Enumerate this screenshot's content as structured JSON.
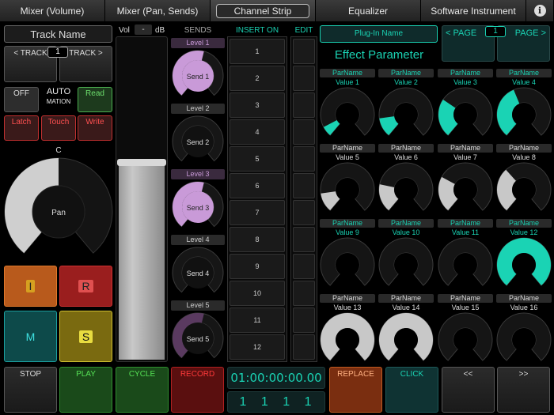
{
  "tabs": [
    {
      "label": "Mixer (Volume)"
    },
    {
      "label": "Mixer (Pan, Sends)"
    },
    {
      "label": "Channel Strip"
    },
    {
      "label": "Equalizer"
    },
    {
      "label": "Software Instrument"
    }
  ],
  "info_icon": "i",
  "track": {
    "name": "Track Name",
    "prev": "< TRACK",
    "next": "TRACK >",
    "number": "1"
  },
  "automation": {
    "off": "OFF",
    "label_line1": "AUTO",
    "label_line2": "MATION",
    "read": "Read",
    "latch": "Latch",
    "touch": "Touch",
    "write": "Write"
  },
  "pan": {
    "center": "C",
    "label": "Pan",
    "value": 0.5
  },
  "channel_buttons": {
    "i": "I",
    "r": "R",
    "m": "M",
    "s": "S"
  },
  "volume": {
    "vol": "Vol",
    "value": "-",
    "unit": "dB",
    "level": 0.62
  },
  "sends": {
    "title": "SENDS",
    "items": [
      {
        "level": "Level 1",
        "label": "Send 1",
        "value": 0.55,
        "active": true
      },
      {
        "level": "Level 2",
        "label": "Send 2",
        "value": 0.0,
        "active": false
      },
      {
        "level": "Level 3",
        "label": "Send 3",
        "value": 0.55,
        "active": true
      },
      {
        "level": "Level 4",
        "label": "Send 4",
        "value": 0.0,
        "active": false
      },
      {
        "level": "Level 5",
        "label": "Send 5",
        "value": 0.55,
        "active": false
      }
    ]
  },
  "inserts": {
    "title": "INSERT ON",
    "edit": "EDIT",
    "slots": [
      "1",
      "2",
      "3",
      "4",
      "5",
      "6",
      "7",
      "8",
      "9",
      "10",
      "11",
      "12"
    ]
  },
  "plugin": {
    "name": "Plug-In Name",
    "page_prev": "< PAGE",
    "page_num": "1",
    "page_next": "PAGE >",
    "title": "Effect Parameter"
  },
  "params": [
    {
      "name": "ParName",
      "value": "Value 1",
      "level": 0.08,
      "color": "#1ad3b4",
      "text_color": "#1ad3b4"
    },
    {
      "name": "ParName",
      "value": "Value 2",
      "level": 0.15,
      "color": "#1ad3b4",
      "text_color": "#1ad3b4"
    },
    {
      "name": "ParName",
      "value": "Value 3",
      "level": 0.3,
      "color": "#1ad3b4",
      "text_color": "#1ad3b4"
    },
    {
      "name": "ParName",
      "value": "Value 4",
      "level": 0.42,
      "color": "#1ad3b4",
      "text_color": "#1ad3b4"
    },
    {
      "name": "ParName",
      "value": "Value 5",
      "level": 0.15,
      "color": "#c8c8c8",
      "text_color": "#dddddd"
    },
    {
      "name": "ParName",
      "value": "Value 6",
      "level": 0.22,
      "color": "#c8c8c8",
      "text_color": "#dddddd"
    },
    {
      "name": "ParName",
      "value": "Value 7",
      "level": 0.28,
      "color": "#c8c8c8",
      "text_color": "#dddddd"
    },
    {
      "name": "ParName",
      "value": "Value 8",
      "level": 0.35,
      "color": "#c8c8c8",
      "text_color": "#dddddd"
    },
    {
      "name": "ParName",
      "value": "Value 9",
      "level": 0.0,
      "color": "#1ad3b4",
      "text_color": "#1ad3b4"
    },
    {
      "name": "ParName",
      "value": "Value 10",
      "level": 0.0,
      "color": "#1ad3b4",
      "text_color": "#1ad3b4"
    },
    {
      "name": "ParName",
      "value": "Value 11",
      "level": 0.0,
      "color": "#1ad3b4",
      "text_color": "#1ad3b4"
    },
    {
      "name": "ParName",
      "value": "Value 12",
      "level": 1.0,
      "color": "#1ad3b4",
      "text_color": "#1ad3b4"
    },
    {
      "name": "ParName",
      "value": "Value 13",
      "level": 1.0,
      "color": "#c8c8c8",
      "text_color": "#dddddd"
    },
    {
      "name": "ParName",
      "value": "Value 14",
      "level": 1.0,
      "color": "#c8c8c8",
      "text_color": "#dddddd"
    },
    {
      "name": "ParName",
      "value": "Value 15",
      "level": 0.0,
      "color": "#c8c8c8",
      "text_color": "#dddddd"
    },
    {
      "name": "ParName",
      "value": "Value 16",
      "level": 0.0,
      "color": "#c8c8c8",
      "text_color": "#dddddd"
    }
  ],
  "transport": {
    "stop": "STOP",
    "play": "PLAY",
    "cycle": "CYCLE",
    "record": "RECORD",
    "time": "01:00:00:00.00",
    "bars": "1 1 1 1",
    "replace": "REPLACE",
    "click": "CLICK",
    "rewind": "<<",
    "forward": ">>"
  },
  "colors": {
    "accent": "#1ad3b4",
    "send": "#c99ad8",
    "record": "#e03030",
    "play": "#3cd03c"
  }
}
